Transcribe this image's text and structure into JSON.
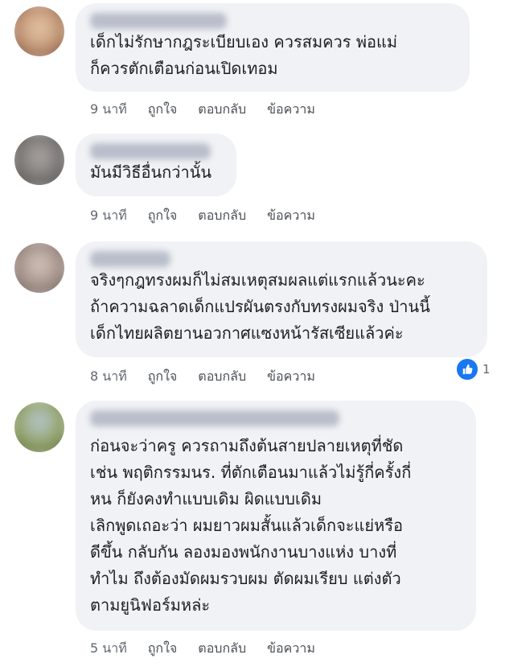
{
  "comments": [
    {
      "text": "เด็กไม่รักษากฎระเบียบเอง ควรสมควร พ่อแม่\nก็ควรตักเตือนก่อนเปิดเทอม",
      "time": "9 นาที",
      "like": "ถูกใจ",
      "reply": "ตอบกลับ",
      "message": "ข้อความ",
      "avatar_color": "#c9a98a"
    },
    {
      "text": "มันมีวิธีอื่นกว่านั้น",
      "time": "9 นาที",
      "like": "ถูกใจ",
      "reply": "ตอบกลับ",
      "message": "ข้อความ",
      "avatar_color": "#8c8c8c"
    },
    {
      "text": "จริงๆกฎทรงผมก็ไม่สมเหตุสมผลแต่แรกแล้วนะคะ\nถ้าความฉลาดเด็กแปรผันตรงกับทรงผมจริง ป่านนี้\nเด็กไทยผลิตยานอวกาศแซงหน้ารัสเซียแล้วค่ะ",
      "time": "8 นาที",
      "like": "ถูกใจ",
      "reply": "ตอบกลับ",
      "message": "ข้อความ",
      "reaction_count": "1",
      "avatar_color": "#b9a8a0"
    },
    {
      "text": "ก่อนจะว่าครู ควรถามถึงต้นสายปลายเหตุที่ชัด\nเช่น พฤติกรรมนร. ที่ตักเตือนมาแล้วไม่รู้กี่ครั้งกี่\nหน ก็ยังคงทำแบบเดิม ผิดแบบเดิม\nเลิกพูดเถอะว่า ผมยาวผมสั้นแล้วเด็กจะแย่หรือ\nดีขึ้น กลับกัน ลองมองพนักงานบางแห่ง บางที่\nทำไม ถึงต้องมัดผมรวบผม ตัดผมเรียบ แต่งตัว\nตามยูนิฟอร์มหล่ะ",
      "time": "5 นาที",
      "like": "ถูกใจ",
      "reply": "ตอบกลับ",
      "message": "ข้อความ",
      "avatar_color": "#8fa06a"
    }
  ],
  "colors": {
    "bubble": "#f0f2f5",
    "like_blue": "#1877f2"
  },
  "icons": {
    "reaction": "thumbs-up-icon"
  }
}
